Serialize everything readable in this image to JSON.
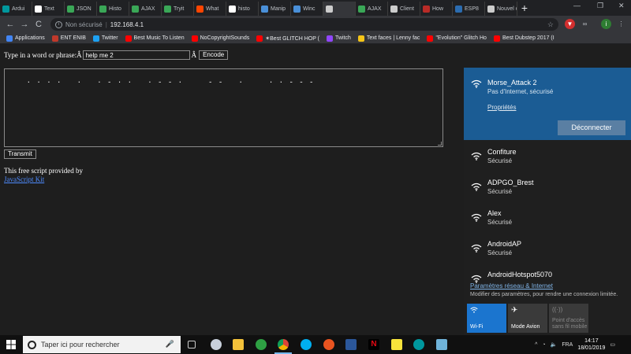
{
  "browser": {
    "tabs": [
      {
        "label": "Ardui",
        "icon": "arduino-icon",
        "color": "#00979d"
      },
      {
        "label": "Text",
        "icon": "notepad-icon",
        "color": "#ffffff"
      },
      {
        "label": "JSON",
        "icon": "code-icon",
        "color": "#3aa757"
      },
      {
        "label": "Histo",
        "icon": "code-icon",
        "color": "#3aa757"
      },
      {
        "label": "AJAX",
        "icon": "code-icon",
        "color": "#3aa757"
      },
      {
        "label": "Tryit",
        "icon": "code-icon",
        "color": "#3aa757"
      },
      {
        "label": "What",
        "icon": "reddit-icon",
        "color": "#ff4500"
      },
      {
        "label": "histo",
        "icon": "google-icon",
        "color": "#ffffff"
      },
      {
        "label": "Manip",
        "icon": "site-icon",
        "color": "#4a90d9"
      },
      {
        "label": "Winc",
        "icon": "site-icon",
        "color": "#4a90d9"
      },
      {
        "label": "",
        "icon": "page-icon",
        "color": "#cccccc"
      },
      {
        "label": "AJAX",
        "icon": "code-icon",
        "color": "#3aa757"
      },
      {
        "label": "Client",
        "icon": "page-icon",
        "color": "#cccccc"
      },
      {
        "label": "How",
        "icon": "quora-icon",
        "color": "#b92b27"
      },
      {
        "label": "ESP8",
        "icon": "r-icon",
        "color": "#2b6cb0"
      },
      {
        "label": "Nouvel o",
        "icon": "page-icon",
        "color": "#cccccc"
      }
    ],
    "active_tab_index": 10,
    "nav": {
      "back": "←",
      "forward": "→",
      "reload": "C"
    },
    "omnibox": {
      "security": "Non sécurisé",
      "separator": "|",
      "url": "192.168.4.1"
    },
    "bookmarks": [
      {
        "label": "Applications",
        "icon": "apps-icon",
        "color": "#4285f4"
      },
      {
        "label": "ENT ENIB",
        "icon": "enib-icon",
        "color": "#c0392b"
      },
      {
        "label": "Twitter",
        "icon": "twitter-icon",
        "color": "#1da1f2"
      },
      {
        "label": "Best Music To Listen",
        "icon": "youtube-icon",
        "color": "#ff0000"
      },
      {
        "label": "NoCopyrightSounds",
        "icon": "youtube-icon",
        "color": "#ff0000"
      },
      {
        "label": "✶Best GLITCH HOP (",
        "icon": "youtube-icon",
        "color": "#ff0000"
      },
      {
        "label": "Twitch",
        "icon": "twitch-icon",
        "color": "#9146ff"
      },
      {
        "label": "Text faces | Lenny fac",
        "icon": "lenny-icon",
        "color": "#f5c518"
      },
      {
        "label": "\"Evolution\" Glitch Ho",
        "icon": "youtube-icon",
        "color": "#ff0000"
      },
      {
        "label": "Best Dubstep 2017 (I",
        "icon": "youtube-icon",
        "color": "#ff0000"
      }
    ]
  },
  "page": {
    "prompt_label": "Type in a word or phrase:Â",
    "input_value": "help me 2",
    "after_input": "Â",
    "encode_label": "Encode",
    "morse_output": "· · · ·   ·   · - · ·   · - - ·     - -   ·     · · - - -",
    "transmit_label": "Transmit",
    "credit_text": "This free script provided by",
    "credit_link": "JavaScript Kit"
  },
  "wifi_flyout": {
    "connected": {
      "name": "Morse_Attack 2",
      "status": "Pas d'Internet, sécurisé",
      "properties": "Propriétés",
      "disconnect": "Déconnecter"
    },
    "networks": [
      {
        "name": "Confiture",
        "status": "Sécurisé"
      },
      {
        "name": "ADPGO_Brest",
        "status": "Sécurisé"
      },
      {
        "name": "Alex",
        "status": "Sécurisé"
      },
      {
        "name": "AndroidAP",
        "status": "Sécurisé"
      },
      {
        "name": "AndroidHotspot5070",
        "status": ""
      }
    ],
    "settings_link": "Paramètres réseau & Internet",
    "settings_sub": "Modifier des paramètres, pour rendre une connexion limitée.",
    "quick_actions": {
      "wifi": "Wi-Fi",
      "airplane": "Mode Avion",
      "hotspot": "Point d'accès sans fil mobile"
    }
  },
  "taskbar": {
    "search_placeholder": "Taper ici pour rechercher",
    "language": "FRA",
    "time": "14:17",
    "date": "18/01/2019",
    "tray_caret": "^",
    "colors": {
      "accent": "#1b75cf",
      "connected_bg": "#1b5c94"
    }
  }
}
